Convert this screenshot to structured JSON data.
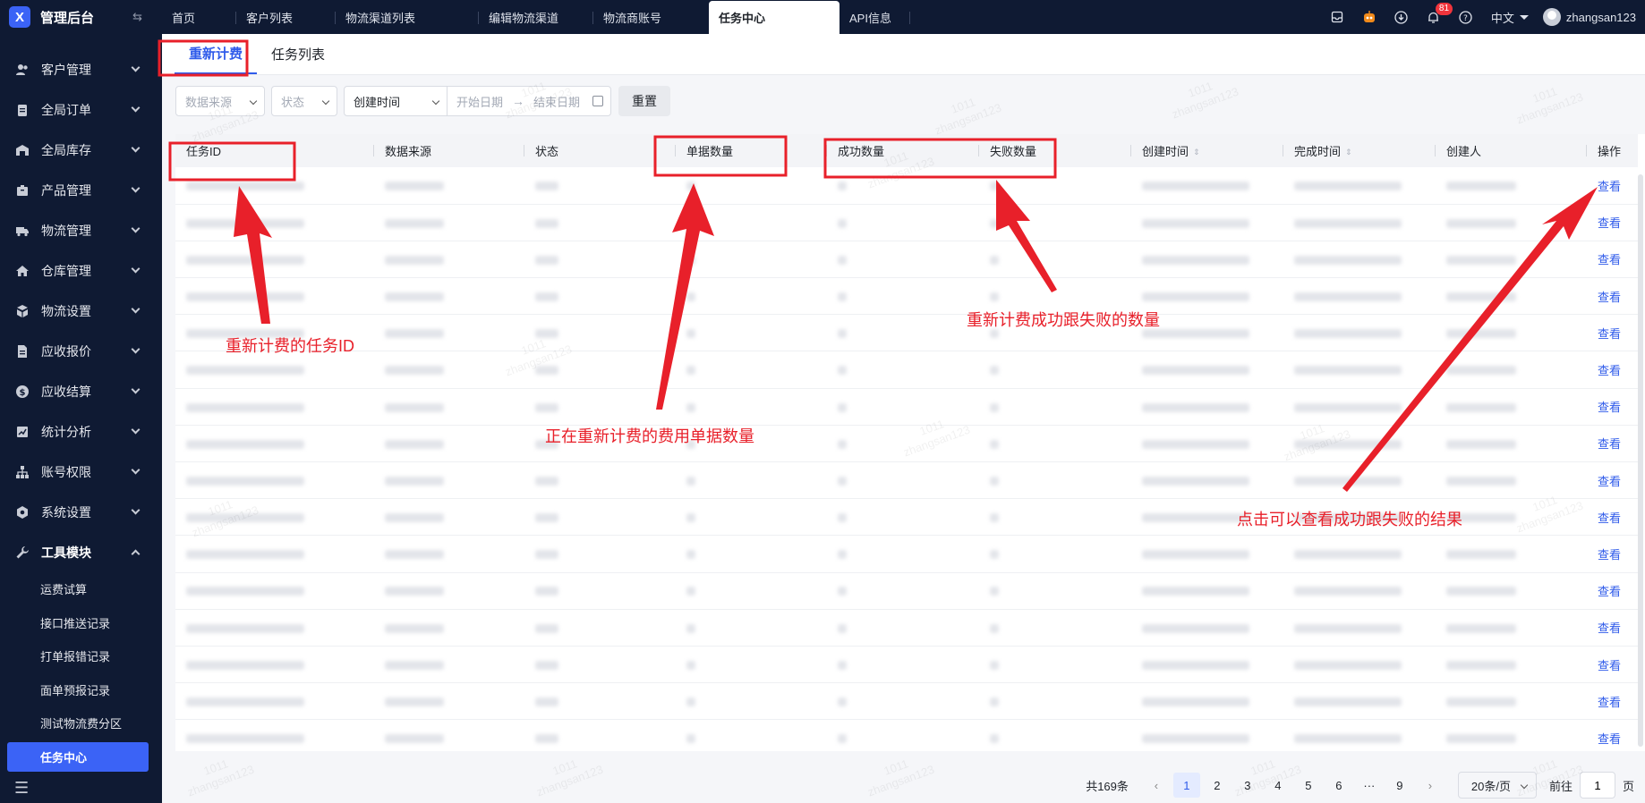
{
  "brand": {
    "logo": "X",
    "title": "管理后台"
  },
  "sidebar": {
    "menu": [
      {
        "label": "客户管理",
        "icon": "users-icon"
      },
      {
        "label": "全局订单",
        "icon": "clipboard-icon"
      },
      {
        "label": "全局库存",
        "icon": "warehouse-icon"
      },
      {
        "label": "产品管理",
        "icon": "box-icon"
      },
      {
        "label": "物流管理",
        "icon": "truck-icon"
      },
      {
        "label": "仓库管理",
        "icon": "home-icon"
      },
      {
        "label": "物流设置",
        "icon": "boxes-icon"
      },
      {
        "label": "应收报价",
        "icon": "document-icon"
      },
      {
        "label": "应收结算",
        "icon": "dollar-icon"
      },
      {
        "label": "统计分析",
        "icon": "chart-icon"
      },
      {
        "label": "账号权限",
        "icon": "org-icon"
      },
      {
        "label": "系统设置",
        "icon": "gear-icon"
      },
      {
        "label": "工具模块",
        "icon": "wrench-icon"
      }
    ],
    "submenu": [
      "运费试算",
      "接口推送记录",
      "打单报错记录",
      "面单预报记录",
      "测试物流费分区",
      "任务中心"
    ]
  },
  "tabs": [
    "首页",
    "客户列表",
    "物流渠道列表",
    "编辑物流渠道",
    "物流商账号",
    "任务中心",
    "API信息"
  ],
  "topbar": {
    "badge": "81",
    "lang": "中文",
    "username": "zhangsan123"
  },
  "subtabs": [
    "重新计费",
    "任务列表"
  ],
  "filters": {
    "source_placeholder": "数据来源",
    "status_placeholder": "状态",
    "date_type": "创建时间",
    "start_placeholder": "开始日期",
    "end_placeholder": "结束日期",
    "reset_label": "重置"
  },
  "table": {
    "columns": [
      "任务ID",
      "数据来源",
      "状态",
      "单据数量",
      "成功数量",
      "失败数量",
      "创建时间",
      "完成时间",
      "创建人",
      "操作"
    ],
    "action_label": "查看",
    "row_count": 16
  },
  "pagination": {
    "total": "共169条",
    "pages": [
      "1",
      "2",
      "3",
      "4",
      "5",
      "6",
      "···",
      "9"
    ],
    "page_size": "20条/页",
    "goto_prefix": "前往",
    "goto_value": "1",
    "goto_suffix": "页"
  },
  "watermark": {
    "line1": "1011",
    "line2": "zhangsan123"
  },
  "annotations": {
    "task_id": "重新计费的任务ID",
    "doc_count": "正在重新计费的费用单据数量",
    "success_fail": "重新计费成功跟失败的数量",
    "view_result": "点击可以查看成功跟失败的结果"
  },
  "colors": {
    "sidebar_bg": "#0f1a33",
    "accent": "#2f5bea",
    "annotation": "#e8202a"
  }
}
